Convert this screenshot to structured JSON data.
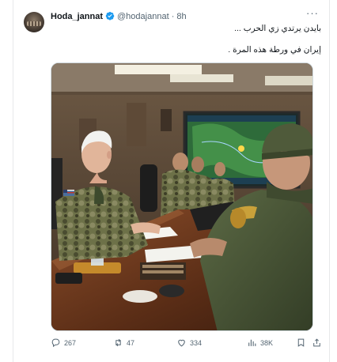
{
  "post": {
    "author_name": "Hoda_jannat",
    "handle": "@hodajannat",
    "separator": "·",
    "time": "8h",
    "text_line1": "بايدن يرتدي زي الحرب ...",
    "text_line2": "إيران في ورطة هذه المرة ."
  },
  "media": {
    "alt": "Photo of men in military uniforms seated around a conference table in a situation room with a map display"
  },
  "actions": {
    "replies": "267",
    "reposts": "47",
    "likes": "334",
    "views": "38K"
  },
  "colors": {
    "verified": "#1d9bf0",
    "icon": "#536471",
    "text": "#0f1419"
  },
  "icons": [
    "more-icon",
    "verified-badge-icon",
    "reply-icon",
    "repost-icon",
    "like-icon",
    "views-icon",
    "bookmark-icon",
    "share-icon"
  ]
}
